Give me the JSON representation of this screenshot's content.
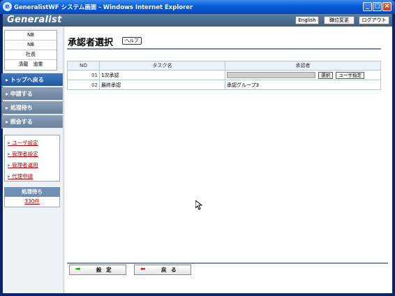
{
  "window": {
    "title": "GeneralistWF システム画面 - Windows Internet Explorer",
    "min": "_",
    "max": "□",
    "close": "×"
  },
  "header": {
    "logo": "Generalist",
    "english": "English",
    "role_change": "職位変更",
    "logout": "ログアウト"
  },
  "user": {
    "line1": "NB",
    "line2": "NB",
    "position": "社長",
    "name": "清龍　道重"
  },
  "nav": {
    "top": "トップへ戻る",
    "apply": "申請する",
    "pending": "処理待ち",
    "inquiry": "照会する"
  },
  "links": {
    "user_settings": "ユーザ設定",
    "admin_settings": "管理者設定",
    "admin_operation": "管理者運用",
    "proxy_apply": "代理申請"
  },
  "pending_box": {
    "header": "処理待ち",
    "count": "330件"
  },
  "page": {
    "title": "承認者選択",
    "help": "ヘルプ"
  },
  "table": {
    "headers": {
      "no": "NO",
      "task": "タスク名",
      "approver": "承認者"
    },
    "rows": [
      {
        "no": "01",
        "task": "1次承認",
        "approver": "",
        "select_btn": "選択",
        "user_btn": "ユーザ指定"
      },
      {
        "no": "02",
        "task": "最終承認",
        "approver": "承認グループ3"
      }
    ]
  },
  "footer": {
    "set_label": "設 定",
    "back_label": "戻 る"
  },
  "colors": {
    "accent": "#6f8fb5",
    "nav_active": "#2357a0",
    "link": "#c00000"
  }
}
